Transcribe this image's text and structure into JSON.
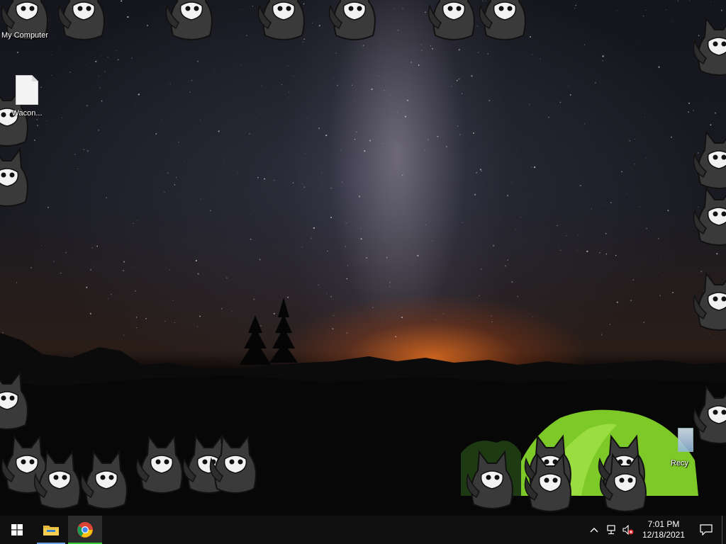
{
  "desktop": {
    "wallpaper": "milky-way-night-sky-with-tent",
    "icons": [
      {
        "name": "my-computer",
        "label": "My Computer",
        "icon": "computer-icon"
      },
      {
        "name": "file",
        "label": "Wacon...",
        "icon": "blank-file-icon"
      },
      {
        "name": "recycle-bin",
        "label": "Recy",
        "icon": "recycle-bin-icon"
      }
    ],
    "overlay": "cartoon-wolf-critters"
  },
  "taskbar": {
    "start": {
      "icon": "windows-logo-icon"
    },
    "apps": [
      {
        "name": "file-explorer",
        "icon": "folder-icon",
        "active": true
      },
      {
        "name": "google-chrome",
        "icon": "chrome-icon",
        "active": true
      }
    ],
    "tray": {
      "overflow_icon": "chevron-up-icon",
      "network_icon": "network-icon",
      "volume_icon": "volume-muted-icon",
      "time": "7:01 PM",
      "date": "12/18/2021",
      "notification_icon": "action-center-icon"
    },
    "colors": {
      "background": "#101010",
      "chrome_highlight": "#38c838",
      "explorer_highlight": "#6aa0e8"
    }
  }
}
